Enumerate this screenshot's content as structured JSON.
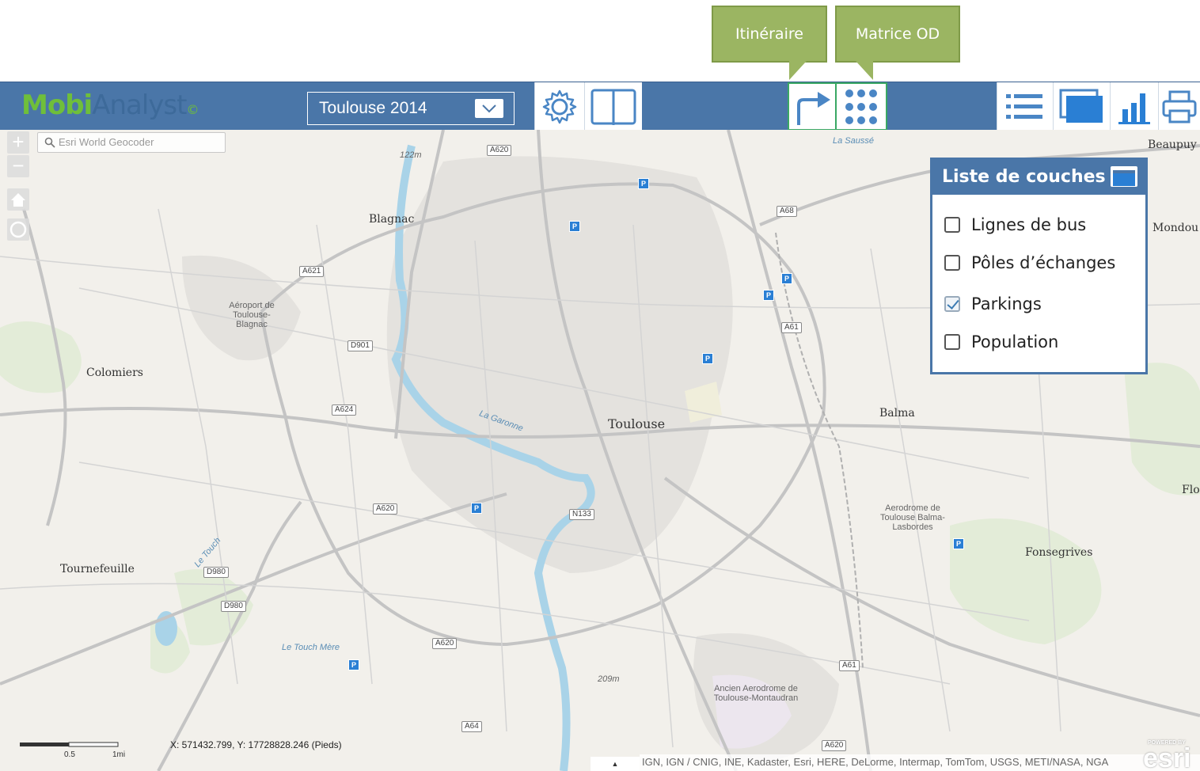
{
  "callouts": {
    "itineraire": "Itinéraire",
    "matrice": "Matrice OD"
  },
  "toolbar": {
    "logo_part1": "Mobi",
    "logo_part2": "Analyst",
    "logo_part3": "©",
    "dataset_selected": "Toulouse 2014"
  },
  "map": {
    "geocoder_placeholder": "Esri World Geocoder",
    "zoom_in": "+",
    "zoom_out": "−",
    "places": {
      "toulouse": "Toulouse",
      "blagnac": "Blagnac",
      "colomiers": "Colomiers",
      "tournefeuille": "Tournefeuille",
      "balma": "Balma",
      "fonsegrives": "Fonsegrives",
      "beaupuy": "Beaupuy",
      "mondou": "Mondou",
      "flo": "Flo",
      "aeroport": "Aéroport de Toulouse-Blagnac",
      "aerodrome_balma": "Aerodrome de Toulouse Balma-Lasbordes",
      "ancien_aerodrome": "Ancien Aerodrome de Toulouse-Montaudran",
      "garonne": "La Garonne",
      "touch": "Le Touch",
      "toulouse_mere": "Le Touch Mère",
      "sausse": "La Saussé"
    },
    "roads": [
      "A620",
      "A621",
      "D901",
      "A624",
      "A68",
      "A61",
      "N133",
      "D980",
      "A64"
    ],
    "elevations": [
      "122m",
      "209m"
    ],
    "scale_labels": [
      "0.5",
      "1mi"
    ],
    "coords": "X: 571432.799, Y: 17728828.246 (Pieds)",
    "attribution": "IGN, IGN / CNIG, INE, Kadaster, Esri, HERE, DeLorme, Intermap, TomTom, USGS, METI/NASA, NGA",
    "esri": "esri",
    "esri_powered": "POWERED BY"
  },
  "layers": {
    "title": "Liste de couches",
    "items": [
      {
        "label": "Lignes de bus",
        "checked": false
      },
      {
        "label": "Pôles d’échanges",
        "checked": false
      },
      {
        "label": "Parkings",
        "checked": true
      },
      {
        "label": "Population",
        "checked": false
      }
    ]
  },
  "colors": {
    "toolbar": "#4a76a8",
    "callout": "#9bb562",
    "selected_border": "#3aa864",
    "parking": "#2a7fd4"
  }
}
